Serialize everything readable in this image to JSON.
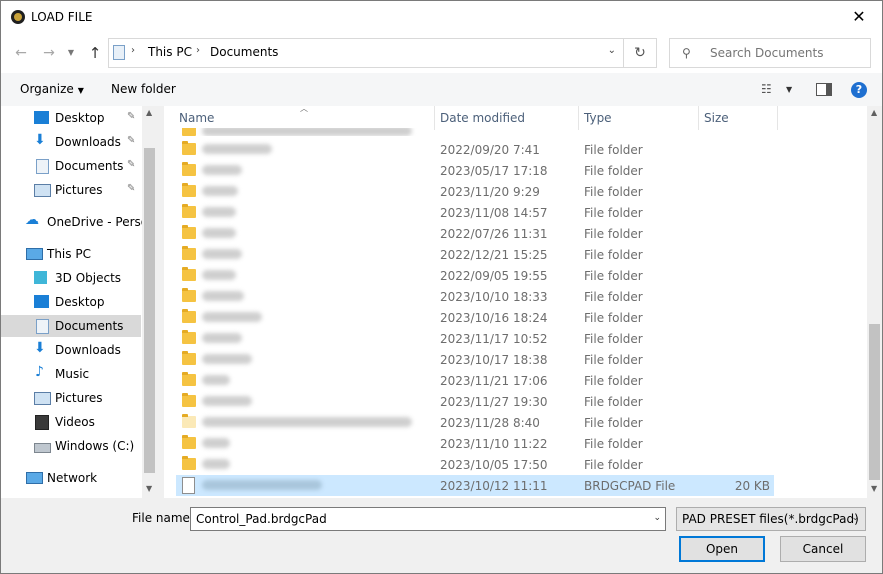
{
  "window": {
    "title": "LOAD FILE"
  },
  "address": {
    "crumbs": [
      "This PC",
      "Documents"
    ]
  },
  "search": {
    "placeholder": "Search Documents"
  },
  "toolbar": {
    "organize_label": "Organize",
    "new_folder_label": "New folder"
  },
  "sidebar": {
    "items": [
      {
        "label": "Desktop",
        "icon": "desktop-icon",
        "pinned": true
      },
      {
        "label": "Downloads",
        "icon": "download-icon",
        "pinned": true
      },
      {
        "label": "Documents",
        "icon": "documents-icon",
        "pinned": true
      },
      {
        "label": "Pictures",
        "icon": "pictures-icon",
        "pinned": true
      },
      {
        "label": "OneDrive - Persor",
        "icon": "onedrive-icon"
      },
      {
        "label": "This PC",
        "icon": "computer-icon"
      },
      {
        "label": "3D Objects",
        "icon": "3d-objects-icon"
      },
      {
        "label": "Desktop",
        "icon": "desktop-icon"
      },
      {
        "label": "Documents",
        "icon": "documents-icon",
        "selected": true
      },
      {
        "label": "Downloads",
        "icon": "download-icon"
      },
      {
        "label": "Music",
        "icon": "music-icon"
      },
      {
        "label": "Pictures",
        "icon": "pictures-icon"
      },
      {
        "label": "Videos",
        "icon": "videos-icon"
      },
      {
        "label": "Windows (C:)",
        "icon": "drive-icon"
      },
      {
        "label": "Network",
        "icon": "network-icon"
      }
    ]
  },
  "columns": {
    "name": "Name",
    "date": "Date modified",
    "type": "Type",
    "size": "Size"
  },
  "files": [
    {
      "date": "2022/09/20 7:41",
      "type": "File folder",
      "size": ""
    },
    {
      "date": "2023/05/17 17:18",
      "type": "File folder",
      "size": ""
    },
    {
      "date": "2023/11/20 9:29",
      "type": "File folder",
      "size": ""
    },
    {
      "date": "2023/11/08 14:57",
      "type": "File folder",
      "size": ""
    },
    {
      "date": "2022/07/26 11:31",
      "type": "File folder",
      "size": ""
    },
    {
      "date": "2022/12/21 15:25",
      "type": "File folder",
      "size": ""
    },
    {
      "date": "2022/09/05 19:55",
      "type": "File folder",
      "size": ""
    },
    {
      "date": "2023/10/10 18:33",
      "type": "File folder",
      "size": ""
    },
    {
      "date": "2023/10/16 18:24",
      "type": "File folder",
      "size": ""
    },
    {
      "date": "2023/11/17 10:52",
      "type": "File folder",
      "size": ""
    },
    {
      "date": "2023/10/17 18:38",
      "type": "File folder",
      "size": ""
    },
    {
      "date": "2023/11/21 17:06",
      "type": "File folder",
      "size": ""
    },
    {
      "date": "2023/11/27 19:30",
      "type": "File folder",
      "size": ""
    },
    {
      "date": "2023/11/28 8:40",
      "type": "File folder",
      "size": ""
    },
    {
      "date": "2023/11/10 11:22",
      "type": "File folder",
      "size": ""
    },
    {
      "date": "2023/10/05 17:50",
      "type": "File folder",
      "size": ""
    },
    {
      "date": "2023/10/12 11:11",
      "type": "BRDGCPAD File",
      "size": "20 KB",
      "selected": true
    }
  ],
  "bottom": {
    "filename_label": "File name:",
    "filename_value": "Control_Pad.brdgcPad",
    "filetype": "PAD PRESET files(*.brdgcPad)",
    "open_label": "Open",
    "cancel_label": "Cancel"
  }
}
